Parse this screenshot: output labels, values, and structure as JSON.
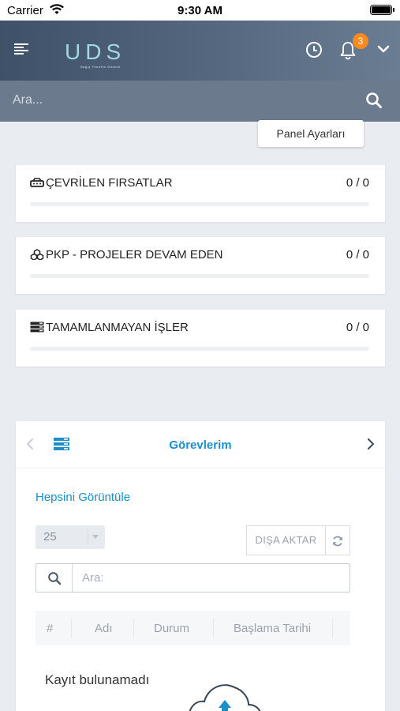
{
  "status_bar": {
    "carrier": "Carrier",
    "time": "9:30 AM"
  },
  "header": {
    "logo_text": "UDS",
    "logo_subtitle": "Bağış Yönetim Sistemi",
    "notification_count": "3"
  },
  "search": {
    "placeholder": "Ara..."
  },
  "panel_settings_label": "Panel Ayarları",
  "summary_cards": [
    {
      "icon": "modem-icon",
      "title": "ÇEVRİLEN FIRSATLAR",
      "count": "0 / 0",
      "progress": 0
    },
    {
      "icon": "cubes-icon",
      "title": "PKP - PROJELER DEVAM EDEN",
      "count": "0 / 0",
      "progress": 0
    },
    {
      "icon": "server-icon",
      "title": "TAMAMLANMAYAN İŞLER",
      "count": "0 / 0",
      "progress": 0
    }
  ],
  "tasks": {
    "title": "Görevlerim",
    "view_all": "Hepsini Görüntüle",
    "page_size": "25",
    "export_label": "DIŞA AKTAR",
    "search_placeholder": "Ara:",
    "columns": [
      "#",
      "Adı",
      "Durum",
      "Başlama Tarihi"
    ],
    "empty_message": "Kayıt bulunamadı"
  },
  "colors": {
    "accent": "#1a8fc8",
    "badge": "#ff8a1e",
    "header_dark": "#3f5168",
    "search_bar": "#6b7a8c"
  }
}
